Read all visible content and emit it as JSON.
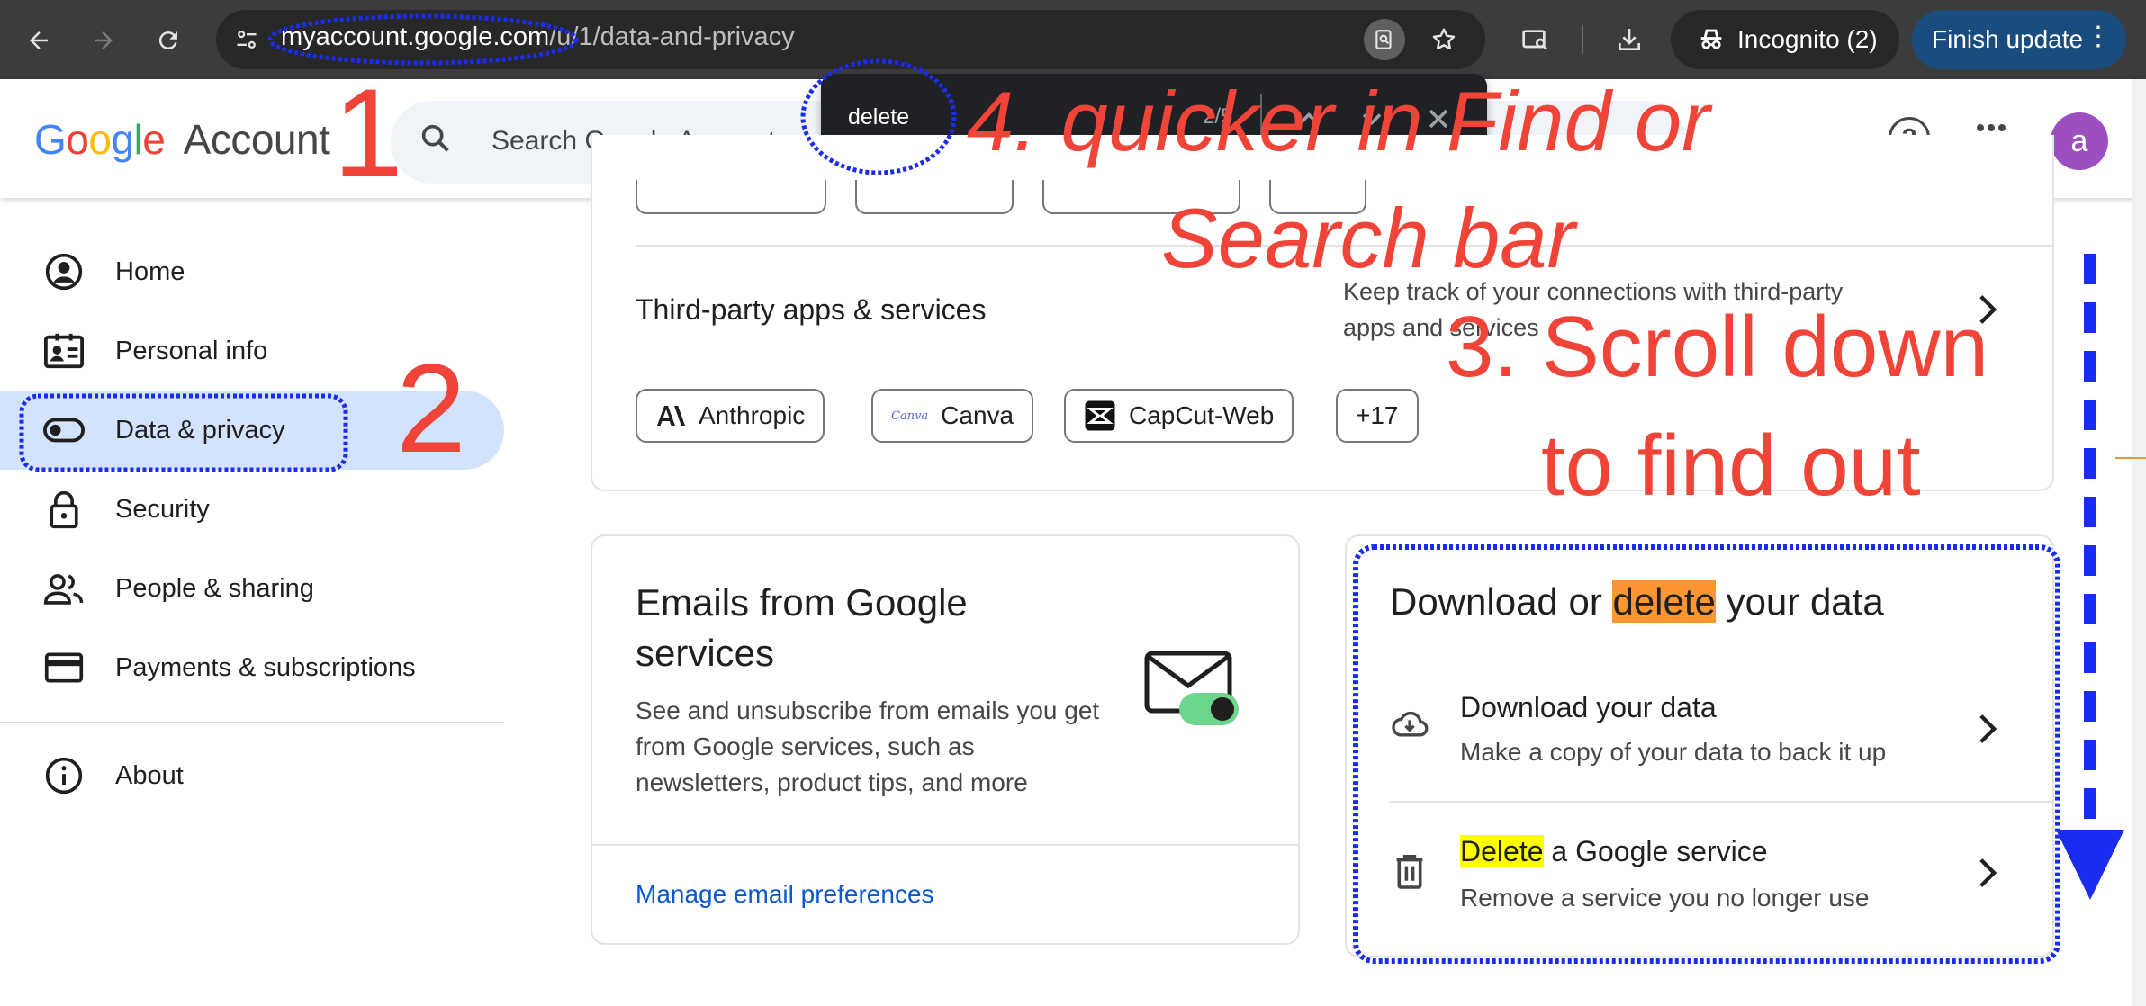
{
  "browser": {
    "url_host": "myaccount.google.com",
    "url_path": "/u/1/data-and-privacy",
    "incognito_label": "Incognito (2)",
    "finish_update_label": "Finish update",
    "more_dots": "⋮"
  },
  "header": {
    "logo_google": [
      "G",
      "o",
      "o",
      "g",
      "l",
      "e"
    ],
    "logo_account": "Account",
    "search_placeholder": "Search Google Account",
    "avatar_letter": "a",
    "help_glyph": "?"
  },
  "find_bar": {
    "query": "delete",
    "count": "2/5"
  },
  "sidebar": {
    "items": [
      {
        "label": "Home",
        "icon": "account-circle-icon"
      },
      {
        "label": "Personal info",
        "icon": "id-card-icon"
      },
      {
        "label": "Data & privacy",
        "icon": "toggle-icon"
      },
      {
        "label": "Security",
        "icon": "lock-icon"
      },
      {
        "label": "People & sharing",
        "icon": "people-icon"
      },
      {
        "label": "Payments & subscriptions",
        "icon": "credit-card-icon"
      },
      {
        "label": "About",
        "icon": "info-icon"
      }
    ]
  },
  "third_party": {
    "title": "Third-party apps & services",
    "description": "Keep track of your connections with third-party apps and services",
    "chips": [
      "Anthropic",
      "Canva",
      "CapCut-Web",
      "+17"
    ],
    "canva_logo": "Canva"
  },
  "emails_card": {
    "title": "Emails from Google services",
    "description": "See and unsubscribe from emails you get from Google services, such as newsletters, product tips, and more",
    "link": "Manage email preferences"
  },
  "download_card": {
    "title_before": "Download or ",
    "title_highlight": "delete",
    "title_after": " your data",
    "items": [
      {
        "title": "Download your data",
        "subtitle": "Make a copy of your data to back it up"
      },
      {
        "title_highlight": "Delete",
        "title_rest": " a Google service",
        "subtitle": "Remove a service you no longer use"
      }
    ]
  },
  "annotations": {
    "step1": "1",
    "step2": "2",
    "step3_line1": "3. Scroll down",
    "step3_line2": "to find out",
    "step4_line1": "4. quicker in Find or",
    "step4_line2": "Search bar",
    "color_red": "#ef4437",
    "color_blue": "#1a2cf0"
  }
}
